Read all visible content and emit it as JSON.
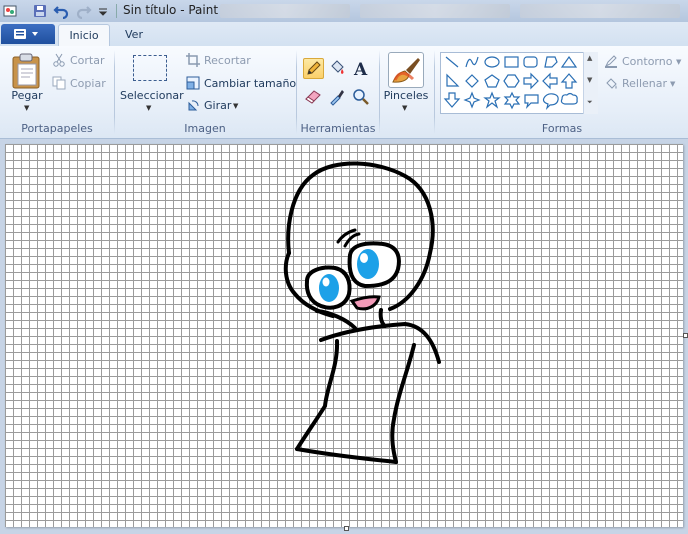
{
  "window": {
    "title": "Sin título - Paint"
  },
  "tabs": [
    {
      "label": "Inicio",
      "active": true
    },
    {
      "label": "Ver",
      "active": false
    }
  ],
  "ribbon": {
    "clipboard": {
      "label": "Portapapeles",
      "paste": "Pegar",
      "cut": "Cortar",
      "copy": "Copiar"
    },
    "image": {
      "label": "Imagen",
      "select": "Seleccionar",
      "crop": "Recortar",
      "resize": "Cambiar tamaño",
      "rotate": "Girar"
    },
    "tools": {
      "label": "Herramientas",
      "selected": "pencil-tool"
    },
    "brushes": {
      "label": "Pinceles"
    },
    "shapes": {
      "label": "Formas",
      "outline": "Contorno",
      "fill": "Rellenar"
    }
  },
  "colors": {
    "accent": "#1f4f9e",
    "eyes": "#1da1e8",
    "mouth": "#f29ab8",
    "selected_tool": "#fbd06a"
  }
}
